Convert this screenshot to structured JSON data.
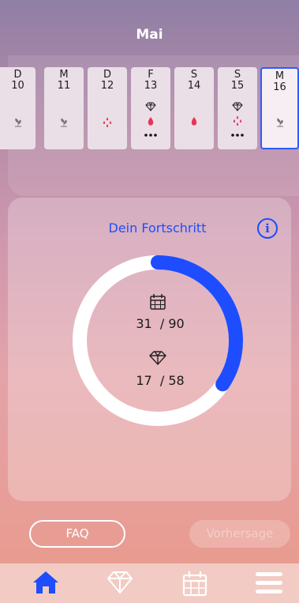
{
  "header": {
    "month": "Mai"
  },
  "days": [
    {
      "letter": "D",
      "number": "10",
      "icons": [
        "sprout"
      ],
      "selected": false
    },
    {
      "letter": "M",
      "number": "11",
      "icons": [
        "sprout"
      ],
      "selected": false
    },
    {
      "letter": "D",
      "number": "12",
      "icons": [
        "drops-small"
      ],
      "selected": false
    },
    {
      "letter": "F",
      "number": "13",
      "icons": [
        "diamond",
        "drop",
        "more"
      ],
      "selected": false
    },
    {
      "letter": "S",
      "number": "14",
      "icons": [
        "drop"
      ],
      "selected": false
    },
    {
      "letter": "S",
      "number": "15",
      "icons": [
        "diamond",
        "drops-small",
        "more"
      ],
      "selected": false
    },
    {
      "letter": "M",
      "number": "16",
      "icons": [
        "sprout"
      ],
      "selected": true
    }
  ],
  "progress": {
    "title": "Dein Fortschritt",
    "info_label": "i",
    "days_done": "31",
    "days_total": "/ 90",
    "gems_done": "17",
    "gems_total": "/ 58",
    "ring_fraction": 0.344
  },
  "buttons": {
    "faq": "FAQ",
    "forecast": "Vorhersage"
  },
  "tabs": [
    "home-icon",
    "diamond-icon",
    "calendar-icon",
    "menu-icon"
  ],
  "colors": {
    "accent": "#1e4dff",
    "drop": "#e8345a",
    "ring_track": "#ffffff"
  }
}
